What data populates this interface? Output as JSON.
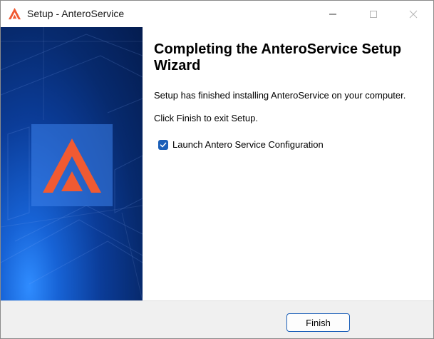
{
  "window": {
    "title": "Setup - AnteroService"
  },
  "content": {
    "heading": "Completing the AnteroService Setup Wizard",
    "message": "Setup has finished installing AnteroService on your computer.",
    "instruction": "Click Finish to exit Setup.",
    "launch_checkbox": {
      "label": "Launch Antero Service Configuration",
      "checked": true
    }
  },
  "buttons": {
    "finish_label": "Finish"
  },
  "icons": {
    "app": "antero-logo-icon",
    "minimize": "minimize-icon",
    "maximize": "maximize-icon",
    "close": "close-icon",
    "check": "checkmark-icon"
  },
  "colors": {
    "brand_orange": "#f05a32",
    "accent_blue": "#1b5fb8",
    "banner_dark": "#041c4f"
  }
}
